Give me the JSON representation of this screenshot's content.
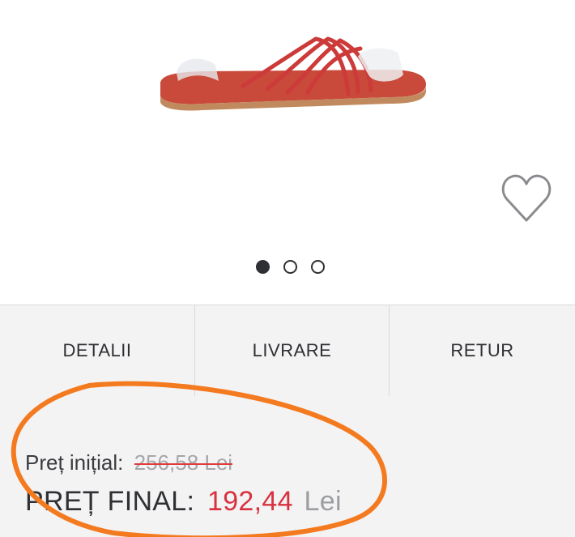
{
  "product": {
    "image_icon": "red-strappy-flat-sandal",
    "wishlist_icon": "heart-outline-icon",
    "carousel": {
      "count": 3,
      "active_index": 0
    }
  },
  "tabs": [
    {
      "label": "DETALII"
    },
    {
      "label": "LIVRARE"
    },
    {
      "label": "RETUR"
    }
  ],
  "price": {
    "initial_label": "Preț inițial:",
    "initial_value": "256,58 Lei",
    "final_label": "PREȚ FINAL:",
    "final_value": "192,44",
    "final_currency": "Lei"
  },
  "colors": {
    "accent_red": "#d8323f",
    "annotation_orange": "#f47a20",
    "panel_bg": "#f3f3f4"
  }
}
